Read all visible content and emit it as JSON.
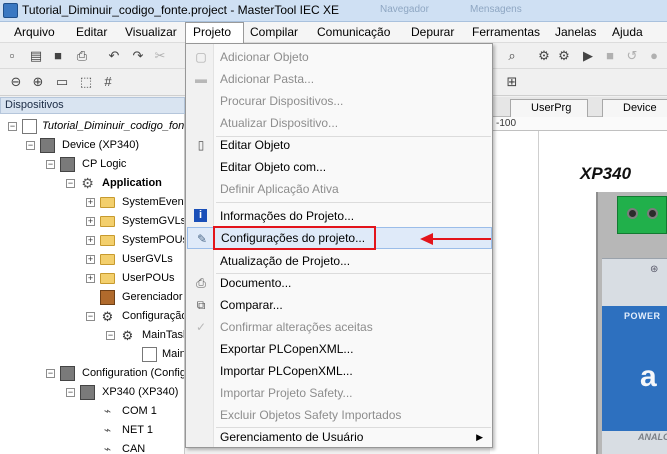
{
  "window": {
    "title": "Tutorial_Diminuir_codigo_fonte.project - MasterTool IEC XE",
    "background_hints": [
      "Navegador",
      "Mensagens"
    ]
  },
  "menubar": [
    "Arquivo",
    "Editar",
    "Visualizar",
    "Projeto",
    "Compilar",
    "Comunicação",
    "Depurar",
    "Ferramentas",
    "Janelas",
    "Ajuda"
  ],
  "active_menu": "Projeto",
  "panel": {
    "title": "Dispositivos"
  },
  "tree": [
    {
      "label": "Tutorial_Diminuir_codigo_fonte",
      "italic": true
    },
    {
      "label": "Device (XP340)"
    },
    {
      "label": "CP Logic"
    },
    {
      "label": "Application",
      "bold": true
    },
    {
      "label": "SystemEvents"
    },
    {
      "label": "SystemGVLs"
    },
    {
      "label": "SystemPOUs"
    },
    {
      "label": "UserGVLs"
    },
    {
      "label": "UserPOUs"
    },
    {
      "label": "Gerenciador"
    },
    {
      "label": "Configuração"
    },
    {
      "label": "MainTask"
    },
    {
      "label": "Main"
    },
    {
      "label": "Configuration (Configuration)"
    },
    {
      "label": "XP340 (XP340)"
    },
    {
      "label": "COM 1"
    },
    {
      "label": "NET 1"
    },
    {
      "label": "CAN"
    }
  ],
  "dropdown": {
    "items": [
      {
        "label": "Adicionar Objeto",
        "disabled": true,
        "icon": "add-object-icon"
      },
      {
        "label": "Adicionar Pasta...",
        "disabled": true,
        "icon": "folder-icon"
      },
      {
        "label": "Procurar Dispositivos...",
        "disabled": true,
        "icon": ""
      },
      {
        "label": "Atualizar Dispositivo...",
        "disabled": true,
        "icon": ""
      },
      {
        "label": "Editar Objeto",
        "disabled": false,
        "icon": "edit-object-icon"
      },
      {
        "label": "Editar Objeto com...",
        "disabled": false,
        "icon": ""
      },
      {
        "label": "Definir Aplicação Ativa",
        "disabled": true,
        "icon": ""
      },
      {
        "label": "Informações do Projeto...",
        "disabled": false,
        "icon": "info-icon"
      },
      {
        "label": "Configurações do projeto...",
        "disabled": false,
        "icon": "settings-icon",
        "highlighted": true
      },
      {
        "label": "Atualização de Projeto...",
        "disabled": false,
        "icon": ""
      },
      {
        "label": "Documento...",
        "disabled": false,
        "icon": "print-icon"
      },
      {
        "label": "Comparar...",
        "disabled": false,
        "icon": "compare-icon"
      },
      {
        "label": "Confirmar alterações aceitas",
        "disabled": true,
        "icon": "confirm-icon"
      },
      {
        "label": "Exportar PLCopenXML...",
        "disabled": false,
        "icon": ""
      },
      {
        "label": "Importar PLCopenXML...",
        "disabled": false,
        "icon": ""
      },
      {
        "label": "Importar Projeto Safety...",
        "disabled": true,
        "icon": ""
      },
      {
        "label": "Excluir Objetos Safety Importados",
        "disabled": true,
        "icon": ""
      },
      {
        "label": "Gerenciamento de Usuário",
        "disabled": false,
        "icon": "",
        "submenu": true
      }
    ]
  },
  "editor": {
    "tabs": [
      "UserPrg",
      "Device"
    ],
    "ruler_label": "-100",
    "device_title": "XP340",
    "device_power_label": "POWER",
    "device_logo": "a",
    "device_footer": "ANALOG"
  },
  "colors": {
    "annotation": "#e3141b",
    "highlight": "#dfeaf9",
    "plc_blue": "#2d70bf",
    "terminal_green": "#21b04b"
  }
}
